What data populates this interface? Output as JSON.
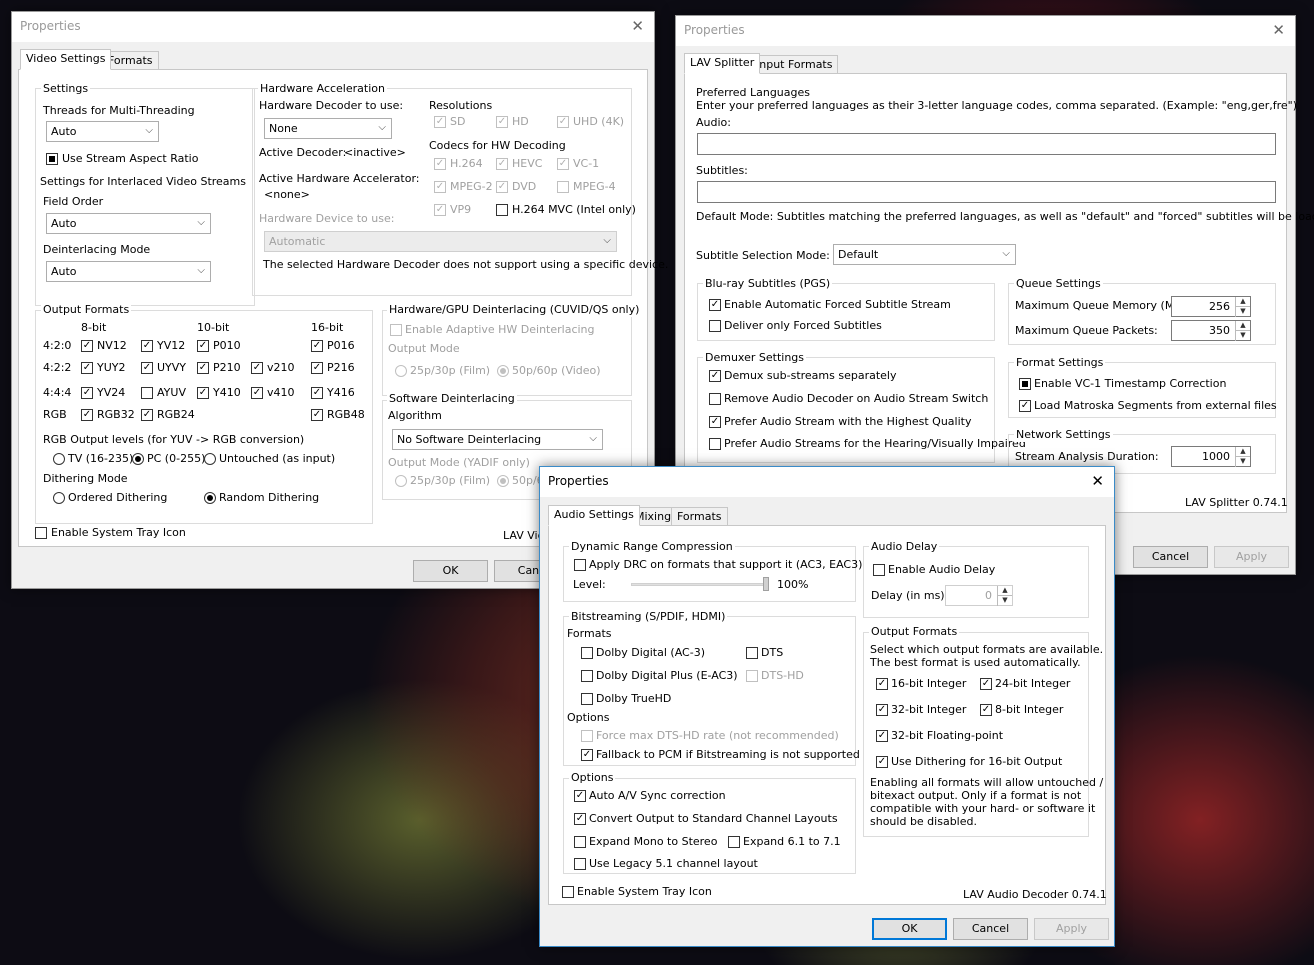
{
  "vid": {
    "title": "Properties",
    "tabs": [
      "Video Settings",
      "Formats"
    ],
    "settings": "Settings",
    "threads_lbl": "Threads for Multi-Threading",
    "threads_val": "Auto",
    "stream_aspect": "Use Stream Aspect Ratio",
    "interlaced_hdr": "Settings for Interlaced Video Streams",
    "field_order_lbl": "Field Order",
    "field_order_val": "Auto",
    "deint_lbl": "Deinterlacing Mode",
    "deint_val": "Auto",
    "hwacc": "Hardware Acceleration",
    "hwdec_lbl": "Hardware Decoder to use:",
    "hwdec_val": "None",
    "active_dec": "Active Decoder:",
    "active_dec_val": "<inactive>",
    "active_acc": "Active Hardware Accelerator:",
    "active_acc_val": "<none>",
    "hwdev_lbl": "Hardware Device to use:",
    "hwdev_val": "Automatic",
    "hwdev_note": "The selected Hardware Decoder does not support using a specific device.",
    "res": "Resolutions",
    "res_items": [
      "SD",
      "HD",
      "UHD (4K)"
    ],
    "codecs": "Codecs for HW Decoding",
    "codec_items": [
      "H.264",
      "HEVC",
      "VC-1",
      "MPEG-2",
      "DVD",
      "MPEG-4",
      "VP9",
      "H.264 MVC (Intel only)"
    ],
    "outfmt": "Output Formats",
    "bits": [
      "8-bit",
      "10-bit",
      "16-bit"
    ],
    "rows": [
      "4:2:0",
      "4:2:2",
      "4:4:4",
      "RGB"
    ],
    "fmts": [
      "NV12",
      "YV12",
      "P010",
      "P016",
      "YUY2",
      "UYVY",
      "P210",
      "v210",
      "P216",
      "YV24",
      "AYUV",
      "Y410",
      "v410",
      "Y416",
      "RGB32",
      "RGB24",
      "RGB48"
    ],
    "rgb_lvl": "RGB Output levels (for YUV -> RGB conversion)",
    "rgb_opts": [
      "TV (16-235)",
      "PC (0-255)",
      "Untouched (as input)"
    ],
    "dith": "Dithering Mode",
    "dith_opts": [
      "Ordered Dithering",
      "Random Dithering"
    ],
    "hwdeint": "Hardware/GPU Deinterlacing (CUVID/QS only)",
    "hwdeint_en": "Enable Adaptive HW Deinterlacing",
    "hwdeint_om": "Output Mode",
    "om_opts": [
      "25p/30p (Film)",
      "50p/60p (Video)"
    ],
    "swdeint": "Software Deinterlacing",
    "algo": "Algorithm",
    "algo_val": "No Software Deinterlacing",
    "yadif_om": "Output Mode (YADIF only)",
    "om2_opts": [
      "25p/30p (Film)",
      "50p/6"
    ],
    "tray": "Enable System Tray Icon",
    "ver": "LAV Vide",
    "ok": "OK",
    "cancel": "Canc"
  },
  "spl": {
    "title": "Properties",
    "tabs": [
      "LAV Splitter",
      "Input Formats"
    ],
    "pref": "Preferred Languages",
    "pref_desc": "Enter your preferred languages as their 3-letter language codes, comma separated. (Example: \"eng,ger,fre\")",
    "audio": "Audio:",
    "subs": "Subtitles:",
    "def_mode": "Default Mode: Subtitles matching the preferred languages, as well as \"default\" and \"forced\" subtitles will be loaded.",
    "ssm": "Subtitle Selection Mode:",
    "ssm_val": "Default",
    "bluray": "Blu-ray Subtitles (PGS)",
    "bluray_items": [
      "Enable Automatic Forced Subtitle Stream",
      "Deliver only Forced Subtitles"
    ],
    "demux": "Demuxer Settings",
    "demux_items": [
      "Demux sub-streams separately",
      "Remove Audio Decoder on Audio Stream Switch",
      "Prefer Audio Stream with the Highest Quality",
      "Prefer Audio Streams for the Hearing/Visually Impaired"
    ],
    "queue": "Queue Settings",
    "qmem": "Maximum Queue Memory (MB):",
    "qmem_val": "256",
    "qpk": "Maximum Queue Packets:",
    "qpk_val": "350",
    "fmtset": "Format Settings",
    "fmt_items": [
      "Enable VC-1 Timestamp Correction",
      "Load Matroska Segments from external files"
    ],
    "net": "Network Settings",
    "sad": "Stream Analysis Duration:",
    "sad_val": "1000",
    "ver": "LAV Splitter 0.74.1",
    "cancel": "Cancel",
    "apply": "Apply"
  },
  "aud": {
    "title": "Properties",
    "tabs": [
      "Audio Settings",
      "Mixing",
      "Formats"
    ],
    "drc": "Dynamic Range Compression",
    "drc_apply": "Apply DRC on formats that support it (AC3, EAC3)",
    "level": "Level:",
    "level_val": "100%",
    "bits": "Bitstreaming (S/PDIF, HDMI)",
    "formats": "Formats",
    "bs_items": [
      "Dolby Digital (AC-3)",
      "DTS",
      "Dolby Digital Plus (E-AC3)",
      "DTS-HD",
      "Dolby TrueHD"
    ],
    "options": "Options",
    "bs_opts": [
      "Force max DTS-HD rate (not recommended)",
      "Fallback to PCM if Bitstreaming is not supported"
    ],
    "opts": "Options",
    "opt_items": [
      "Auto A/V Sync correction",
      "Convert Output to Standard Channel Layouts",
      "Expand Mono to Stereo",
      "Expand 6.1 to 7.1",
      "Use Legacy 5.1 channel layout"
    ],
    "tray": "Enable System Tray Icon",
    "delay": "Audio Delay",
    "delay_en": "Enable Audio Delay",
    "delay_lbl": "Delay (in ms):",
    "delay_val": "0",
    "outfmt": "Output Formats",
    "out_desc1": "Select which output formats are available.",
    "out_desc2": "The best format is used automatically.",
    "out_items": [
      "16-bit Integer",
      "24-bit Integer",
      "32-bit Integer",
      "8-bit Integer",
      "32-bit Floating-point",
      "Use Dithering for 16-bit Output"
    ],
    "note1": "Enabling all formats will allow untouched /",
    "note2": "bitexact output. Only if a format is not",
    "note3": "compatible with your hard- or software it",
    "note4": "should be disabled.",
    "ver": "LAV Audio Decoder 0.74.1",
    "ok": "OK",
    "cancel": "Cancel",
    "apply": "Apply"
  }
}
